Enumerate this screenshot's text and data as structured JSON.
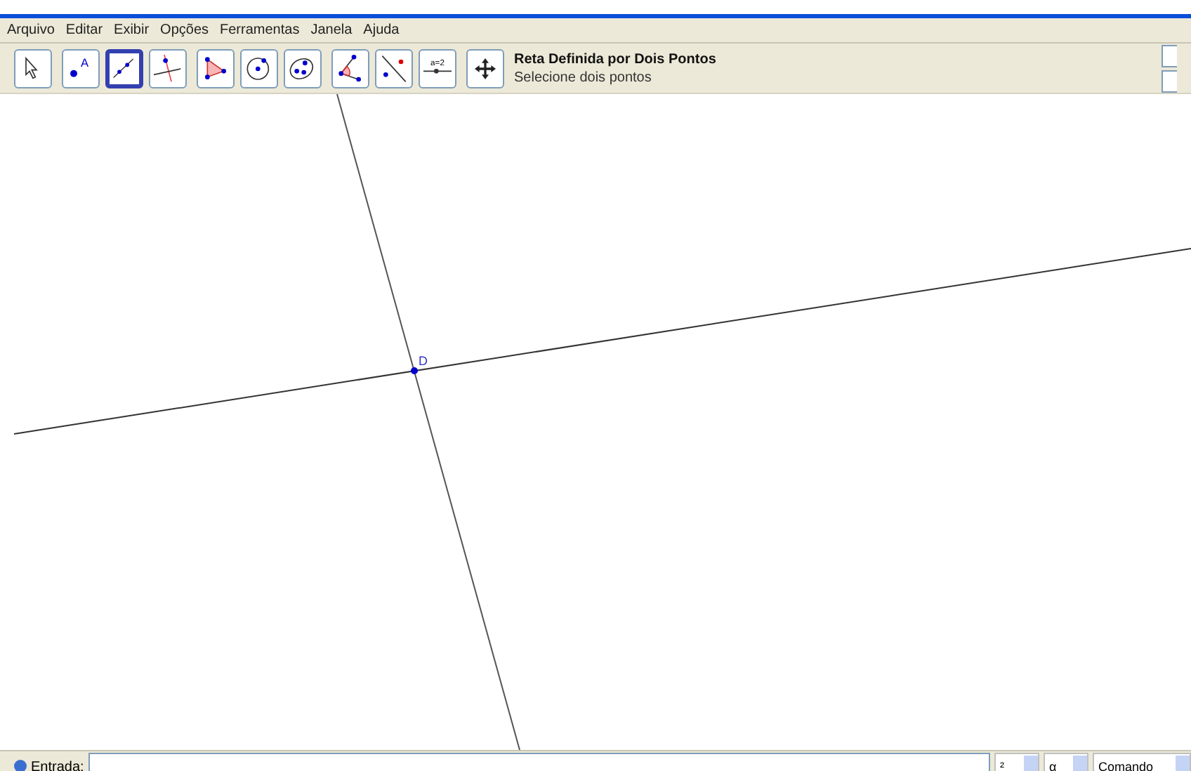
{
  "menu": [
    "Arquivo",
    "Editar",
    "Exibir",
    "Opções",
    "Ferramentas",
    "Janela",
    "Ajuda"
  ],
  "toolbar": {
    "groups": [
      {
        "tools": [
          {
            "kind": "move",
            "selected": false
          }
        ]
      },
      {
        "tools": [
          {
            "kind": "point",
            "selected": false,
            "label": "A"
          },
          {
            "kind": "line",
            "selected": true
          },
          {
            "kind": "perpendicular",
            "selected": false
          }
        ]
      },
      {
        "tools": [
          {
            "kind": "polygon",
            "selected": false
          },
          {
            "kind": "circle",
            "selected": false
          },
          {
            "kind": "conic",
            "selected": false
          }
        ]
      },
      {
        "tools": [
          {
            "kind": "angle",
            "selected": false
          },
          {
            "kind": "reflect",
            "selected": false
          },
          {
            "kind": "slider",
            "selected": false,
            "label": "a=2"
          }
        ]
      },
      {
        "tools": [
          {
            "kind": "pan",
            "selected": false
          }
        ]
      }
    ],
    "tool_name": "Reta Definida por Dois Pontos",
    "tool_help": "Selecione dois pontos"
  },
  "canvas": {
    "point_label": "D"
  },
  "input_bar": {
    "label": "Entrada:",
    "dropdowns": [
      "²",
      "α",
      "Comando"
    ]
  }
}
